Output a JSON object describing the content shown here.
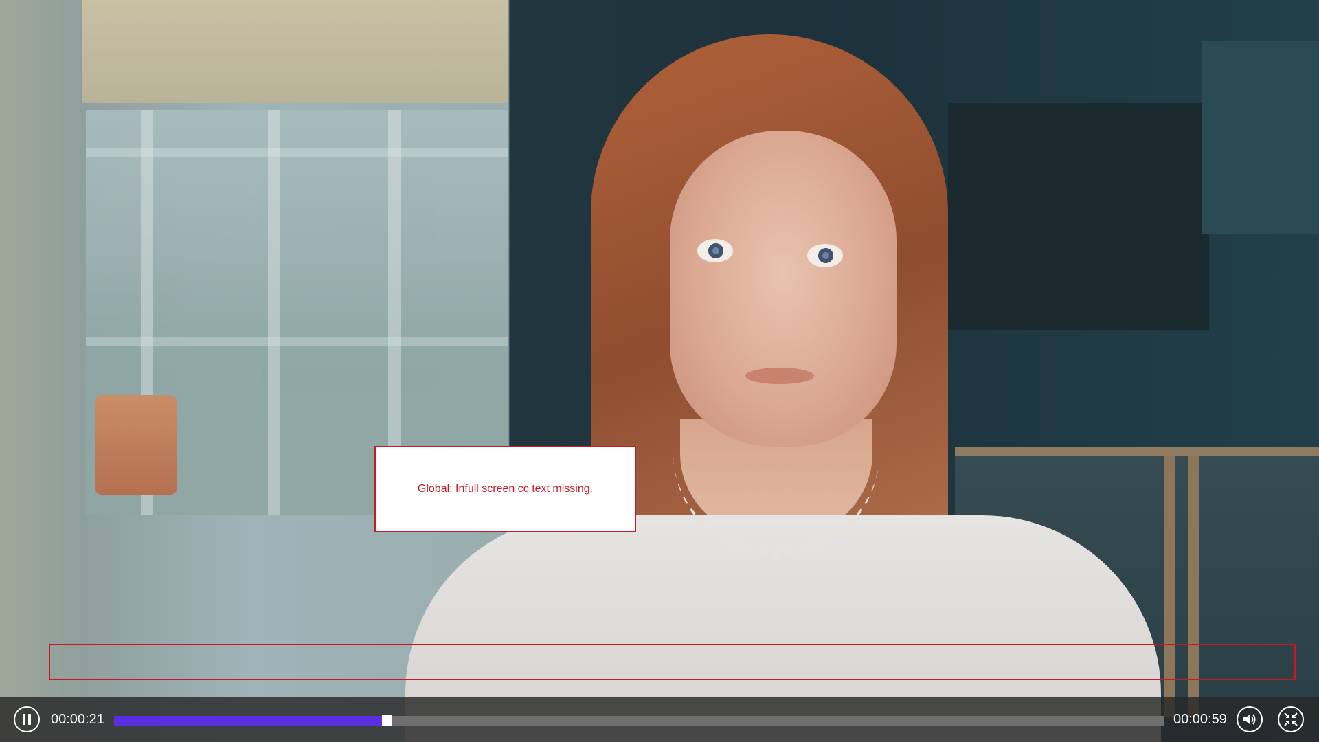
{
  "video": {
    "annotation_text": "Global: Infull screen cc text missing."
  },
  "player": {
    "current_time": "00:00:21",
    "total_time": "00:00:59",
    "progress_percent": 26,
    "progress_color": "#5b2ee0",
    "buttons": {
      "pause_icon": "pause-icon",
      "volume_icon": "volume-icon",
      "fullscreen_exit_icon": "exit-fullscreen-icon"
    }
  },
  "colors": {
    "annotation_red": "#c61b24",
    "control_bar": "#282828"
  }
}
